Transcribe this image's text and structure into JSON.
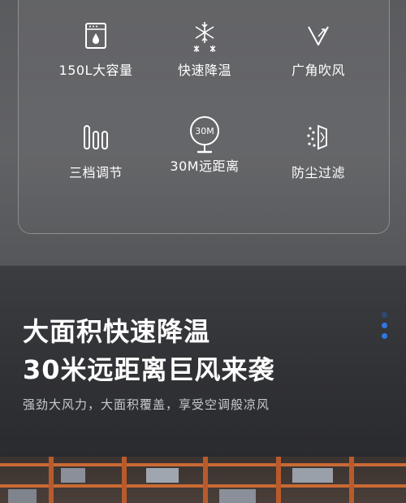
{
  "features": [
    {
      "icon": "washer-icon",
      "label": "150L大容量"
    },
    {
      "icon": "snowflake-icon",
      "label": "快速降温"
    },
    {
      "icon": "wide-angle-icon",
      "label": "广角吹风"
    },
    {
      "icon": "three-gear-icon",
      "label": "三档调节"
    },
    {
      "icon": "fan-30m-icon",
      "label": "30M远距离",
      "icon_text": "30M"
    },
    {
      "icon": "dust-filter-icon",
      "label": "防尘过滤"
    }
  ],
  "hero": {
    "title_line1": "大面积快速降温",
    "title_line2": "30米远距离巨风来袭",
    "subtitle": "强劲大风力，大面积覆盖，享受空调般凉风"
  },
  "pager": {
    "count": 3,
    "active_index": 2
  },
  "colors": {
    "accent": "#2e78e6",
    "text": "#ffffff",
    "subtext": "#c9cacc"
  }
}
